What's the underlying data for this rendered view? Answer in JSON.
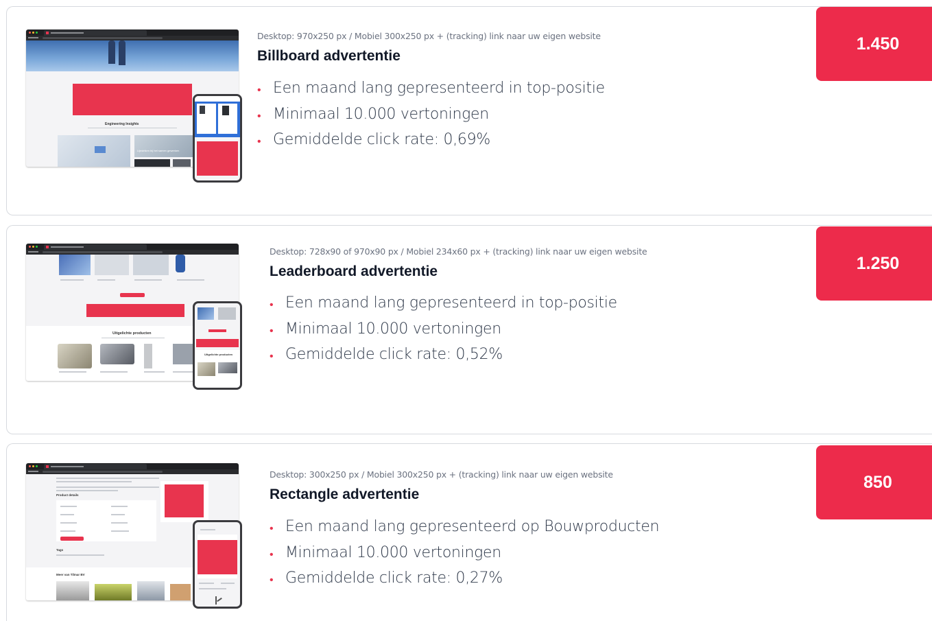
{
  "colors": {
    "accent": "#ed2b4b",
    "price_text": "#ffffff",
    "border": "#d6d9de"
  },
  "packages": [
    {
      "spec": "Desktop: 970x250 px / Mobiel 300x250 px + (tracking) link naar uw eigen website",
      "title": "Billboard advertentie",
      "bullets": [
        "Een maand lang gepresenteerd in top-positie",
        "Minimaal 10.000 vertoningen",
        "Gemiddelde click rate: 0,69%"
      ],
      "price": "1.450",
      "preview": {
        "heading": "Engineering Insights",
        "card_caption": "Lijnstriken bij het samen gewerken"
      }
    },
    {
      "spec": "Desktop: 728x90 of 970x90 px / Mobiel 234x60 px + (tracking) link naar uw eigen website",
      "title": "Leaderboard advertentie",
      "bullets": [
        "Een maand lang gepresenteerd in top-positie",
        "Minimaal 10.000 vertoningen",
        "Gemiddelde click rate: 0,52%"
      ],
      "price": "1.250",
      "preview": {
        "heading": "Uitgelichte producten",
        "mobile_heading": "Uitgelichte producten"
      }
    },
    {
      "spec": "Desktop: 300x250 px / Mobiel 300x250 px + (tracking) link naar uw eigen website",
      "title": "Rectangle advertentie",
      "bullets": [
        "Een maand lang gepresenteerd op Bouwproducten",
        "Minimaal 10.000 vertoningen",
        "Gemiddelde click rate: 0,27%"
      ],
      "price": "850",
      "preview": {
        "section_product": "Product details",
        "section_tags": "Tags",
        "section_more": "Meer van Tilmar BV"
      }
    }
  ]
}
